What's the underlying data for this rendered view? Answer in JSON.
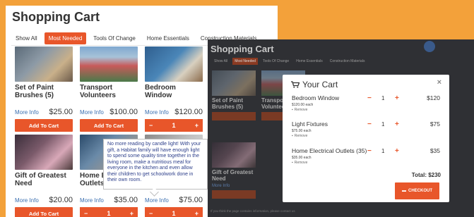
{
  "shop": {
    "title": "Shopping Cart",
    "tabs": [
      "Show All",
      "Most Needed",
      "Tools Of Change",
      "Home Essentials",
      "Construction Materials"
    ],
    "active_tab": "Most Needed",
    "more_info": "More Info",
    "add_to_cart": "Add To Cart",
    "products": [
      {
        "name": "Set of Paint Brushes (5)",
        "price": "$25.00",
        "image": "paint-brushes-photo"
      },
      {
        "name": "Transport Volunteers",
        "price": "$100.00",
        "image": "volunteers-group-photo"
      },
      {
        "name": "Bedroom Window",
        "price": "$120.00",
        "image": "bedroom-window-photo",
        "qty": "1"
      },
      {
        "name": "Gift of Greatest Need",
        "price": "$20.00",
        "image": "family-photo"
      },
      {
        "name": "Home Electrical Outlets",
        "price": "$35.00",
        "image": "electrical-outlets-photo",
        "qty": "1"
      },
      {
        "name": "",
        "price": "$75.00",
        "image": "light-fixtures-photo",
        "qty": "1"
      }
    ],
    "tooltip": "No more reading by candle light! With your gift, a Habitat family will have enough light to spend some quality time together in the living room, make a nutritious meal for everyone in the kitchen and even allow their children to get schoolwork done in their own room."
  },
  "background_page": {
    "title": "Shopping Cart",
    "tabs": [
      "Show All",
      "Most Needed",
      "Tools Of Change",
      "Home Essentials",
      "Construction Materials"
    ],
    "products": [
      "Set of Paint Brushes (5)",
      "Transport Volunteers",
      "Gift of Greatest Need"
    ],
    "more_info": "More Info",
    "footer": "If you think the page contains information, please contact us"
  },
  "cart": {
    "title": "Your Cart",
    "items": [
      {
        "name": "Bedroom Window",
        "each": "$120.00 each",
        "remove": "Remove",
        "qty": "1",
        "price": "$120"
      },
      {
        "name": "Light Fixtures",
        "each": "$75.00 each",
        "remove": "Remove",
        "qty": "1",
        "price": "$75"
      },
      {
        "name": "Home Electrical Outlets (35)",
        "each": "$35.00 each",
        "remove": "Remove",
        "qty": "1",
        "price": "$35"
      }
    ],
    "total": "Total: $230",
    "checkout": "CHECKOUT"
  },
  "colors": {
    "accent": "#e8562a",
    "page_bg": "#f3a13a",
    "link": "#3a6fb0"
  }
}
